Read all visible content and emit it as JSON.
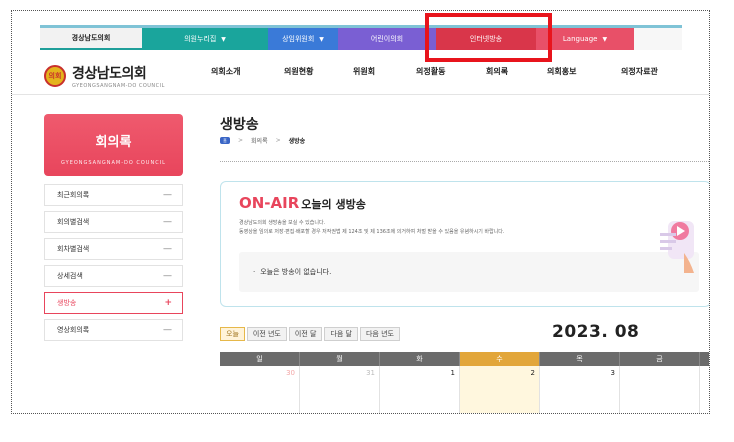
{
  "topbar": {
    "home": "경상남도의회",
    "items": [
      {
        "label": "의원누리집",
        "caret": "▼"
      },
      {
        "label": "상임위원회",
        "caret": "▼"
      },
      {
        "label": "어린이의회",
        "caret": ""
      },
      {
        "label": "인터넷방송",
        "caret": ""
      },
      {
        "label": "Language",
        "caret": "▼"
      }
    ]
  },
  "header": {
    "logo_mark": "의회",
    "logo_title": "경상남도의회",
    "logo_subtitle": "GYEONGSANGNAM-DO COUNCIL",
    "gnb": [
      "의회소개",
      "의원현황",
      "위원회",
      "의정활동",
      "회의록",
      "의회홍보",
      "의정자료관"
    ]
  },
  "sidebar": {
    "title": "회의록",
    "subtitle": "GYEONGSANGNAM-DO COUNCIL",
    "items": [
      {
        "label": "최근회의록",
        "mark": "—"
      },
      {
        "label": "회의별검색",
        "mark": "—"
      },
      {
        "label": "회차별검색",
        "mark": "—"
      },
      {
        "label": "상세검색",
        "mark": "—"
      },
      {
        "label": "생방송",
        "mark": "+"
      },
      {
        "label": "영상회의록",
        "mark": "—"
      }
    ]
  },
  "main": {
    "page_title": "생방송",
    "breadcrumb": {
      "home_icon": "홈",
      "sep": ">",
      "level1": "회의록",
      "current": "생방송"
    },
    "onair": {
      "title_red": "ON-AIR",
      "title_dark": "오늘의 생방송",
      "notice1": "경상남도의회 생방송을 보실 수 있습니다.",
      "notice2": "동영상을 임의로 저장·편집·배포할 경우 저작권법 제 124조 및 제 136조에 의거하여 처벌 받을 수 있음을 유념하시기 바랍니다.",
      "bullet": "·",
      "empty_message": "오늘은 방송이 없습니다."
    },
    "calendar": {
      "buttons": [
        "오늘",
        "이전 년도",
        "이전 달",
        "다음 달",
        "다음 년도"
      ],
      "month": "2023. 08",
      "weekdays": [
        "일",
        "월",
        "화",
        "수",
        "목",
        "금"
      ],
      "first_row": [
        "30",
        "31",
        "1",
        "2",
        "3",
        ""
      ]
    }
  },
  "colors": {
    "accent_red": "#e8455c",
    "highlight_box": "#e8141c",
    "teal": "#1aa59c",
    "blue": "#3a7ad8",
    "purple": "#7a5fd3"
  }
}
